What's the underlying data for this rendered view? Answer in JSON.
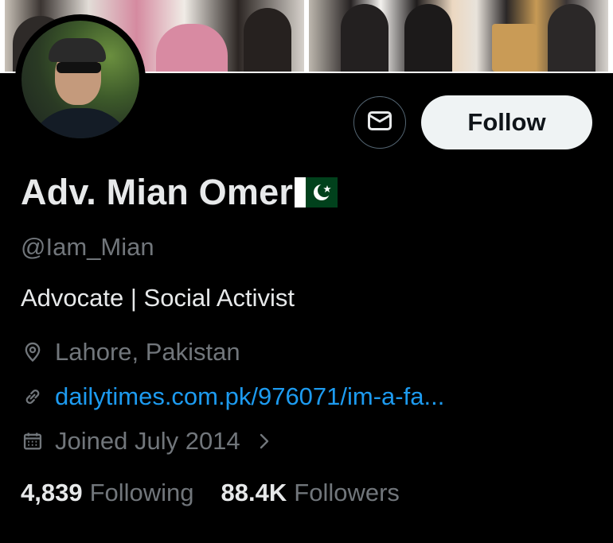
{
  "profile": {
    "display_name": "Adv. Mian Omer",
    "flag_emoji": "pakistan-flag",
    "handle": "@Iam_Mian",
    "bio": "Advocate | Social Activist",
    "location": "Lahore, Pakistan",
    "website": "dailytimes.com.pk/976071/im-a-fa...",
    "joined": "Joined July 2014"
  },
  "actions": {
    "follow_label": "Follow",
    "message_icon": "envelope-icon"
  },
  "stats": {
    "following_count": "4,839",
    "following_label": "Following",
    "followers_count": "88.4K",
    "followers_label": "Followers"
  },
  "icons": {
    "location": "map-pin-icon",
    "link": "link-icon",
    "calendar": "calendar-icon",
    "chevron": "chevron-right-icon"
  },
  "colors": {
    "background": "#000000",
    "primary_text": "#e7e9ea",
    "secondary_text": "#71767b",
    "link": "#1d9bf0",
    "follow_button_bg": "#eff3f4",
    "follow_button_text": "#0f1419",
    "border": "#536471"
  }
}
